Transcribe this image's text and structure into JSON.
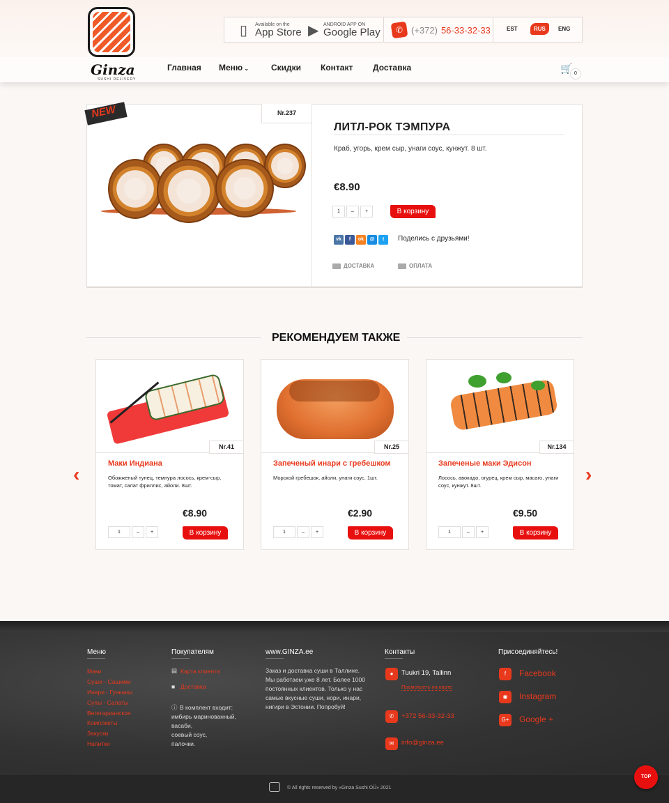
{
  "header": {
    "logo_text": "Ginza",
    "logo_sub": "SUSHI DELIVERY",
    "appstore": {
      "small": "Available on the",
      "big": "App Store"
    },
    "googleplay": {
      "small": "ANDROID APP ON",
      "big": "Google Play"
    },
    "phone_code": "(+372)",
    "phone_number": "56-33-32-33",
    "languages": [
      {
        "label": "EST",
        "active": false
      },
      {
        "label": "RUS",
        "active": true
      },
      {
        "label": "ENG",
        "active": false
      }
    ],
    "nav": [
      "Главная",
      "Меню",
      "Скидки",
      "Контакт",
      "Доставка"
    ],
    "cart_count": "0"
  },
  "product": {
    "badge": "NEW",
    "nr": "Nr.237",
    "title": "ЛИТЛ-РОК ТЭМПУРА",
    "description": "Краб, угорь, крем сыр, унаги соус, кунжут. 8 шт.",
    "price": "€8.90",
    "qty": "1",
    "minus": "–",
    "plus": "+",
    "add_to_cart": "В корзину",
    "share_text": "Поделись с друзьями!",
    "share_icons": [
      "vk-icon",
      "facebook-icon",
      "odnoklassniki-icon",
      "mailru-icon",
      "twitter-icon"
    ],
    "delivery_label": "ДОСТАВКА",
    "payment_label": "ОПЛАТА"
  },
  "recommended": {
    "title": "РЕКОМЕНДУЕМ ТАКЖЕ",
    "items": [
      {
        "nr": "Nr.41",
        "name": "Маки Индиана",
        "description": "Обожженый тунец, темпура лосось, крем-сыр, томат, салат фриллис, айоли. 8шт.",
        "price": "€8.90",
        "qty": "1",
        "minus": "–",
        "plus": "+",
        "add_to_cart": "В корзину"
      },
      {
        "nr": "Nr.25",
        "name": "Запеченый инари с гребешком",
        "description": "Морской гребешок, айоли, унаги соус. 1шт.",
        "price": "€2.90",
        "qty": "1",
        "minus": "–",
        "plus": "+",
        "add_to_cart": "В корзину"
      },
      {
        "nr": "Nr.134",
        "name": "Запеченые маки Эдисон",
        "description": "Лосось, авокадо, огурец, крем сыр, масаго, унаги соус, кунжут. 8шт.",
        "price": "€9.50",
        "qty": "1",
        "minus": "–",
        "plus": "+",
        "add_to_cart": "В корзину"
      }
    ]
  },
  "footer": {
    "menu_title": "Меню",
    "menu_items": [
      "Маки",
      "Суши - Сашими",
      "Инари - Гунканы",
      "Супы - Салаты",
      "Вегетарианское",
      "Комплекты",
      "Закуски",
      "Напитки"
    ],
    "buyers_title": "Покупателям",
    "client_card": "Карта клиента",
    "delivery": "Доставка",
    "kit_title": "В комплект входит:",
    "kit_items": [
      "имбирь маринованный,",
      "васаби,",
      "соевый соус,",
      "палочки."
    ],
    "site_title": "www.GINZA.ee",
    "site_text": [
      "Заказ и доставка суши в Таллине.",
      "Мы работаем уже 8 лет. Более 1000",
      "постоянных клиентов. Только у нас",
      "самые вкусные суши, нори, инари,",
      "нигири в Эстонии. Попробуй!"
    ],
    "contacts_title": "Контакты",
    "address": "Tuukri 19, Tallinn",
    "map_link": "Посмотреть на карте",
    "phone": "+372 56-33-32-33",
    "email": "info@ginza.ee",
    "join_title": "Присоединяйтесь!",
    "social": [
      "Facebook",
      "Instagram",
      "Google +"
    ],
    "copyright": "© All rights reserved by «Ginza Sushi OÜ» 2021",
    "totop": "TOP"
  },
  "colors": {
    "accent": "#e8391d",
    "button": "#e8100f",
    "footer_bg": "#333333"
  }
}
